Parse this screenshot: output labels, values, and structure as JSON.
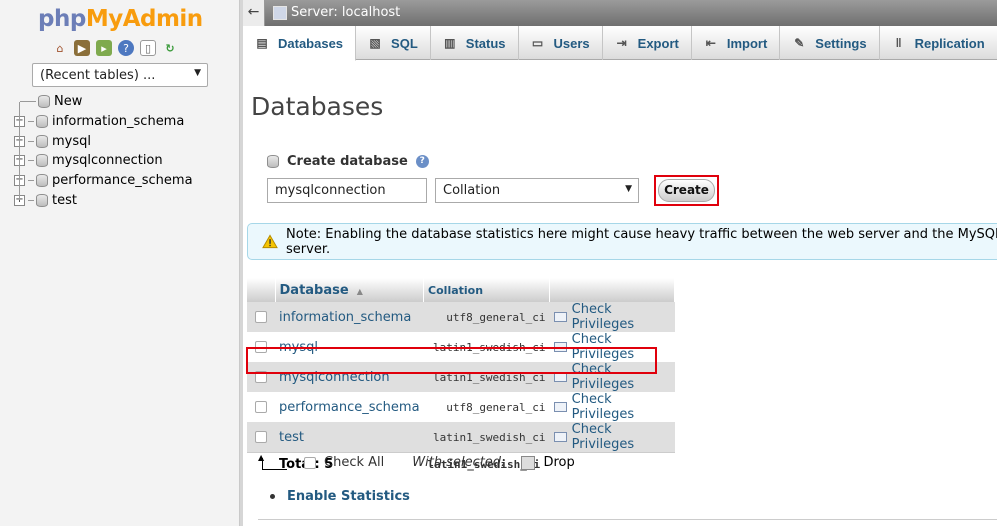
{
  "sidebar": {
    "logo_php": "php",
    "logo_myadmin": "MyAdmin",
    "quick_icons": [
      "home-icon",
      "exit-icon",
      "query-window-icon",
      "documentation-icon",
      "copy-icon",
      "reload-icon"
    ],
    "recent_tables": "(Recent tables) ...",
    "tree": [
      {
        "label": "New",
        "expandable": false
      },
      {
        "label": "information_schema",
        "expandable": true
      },
      {
        "label": "mysql",
        "expandable": true
      },
      {
        "label": "mysqlconnection",
        "expandable": true
      },
      {
        "label": "performance_schema",
        "expandable": true
      },
      {
        "label": "test",
        "expandable": true
      }
    ]
  },
  "topbar": {
    "back": "←",
    "server": "Server: localhost"
  },
  "tabs": [
    {
      "label": "Databases",
      "icon": "database-icon",
      "active": true
    },
    {
      "label": "SQL",
      "icon": "sql-icon",
      "active": false
    },
    {
      "label": "Status",
      "icon": "status-icon",
      "active": false
    },
    {
      "label": "Users",
      "icon": "users-icon",
      "active": false
    },
    {
      "label": "Export",
      "icon": "export-icon",
      "active": false
    },
    {
      "label": "Import",
      "icon": "import-icon",
      "active": false
    },
    {
      "label": "Settings",
      "icon": "settings-icon",
      "active": false
    },
    {
      "label": "Replication",
      "icon": "replication-icon",
      "active": false
    }
  ],
  "main": {
    "title": "Databases",
    "create_label": "Create database",
    "db_name_value": "mysqlconnection",
    "collation_value": "Collation",
    "create_button": "Create",
    "notice": "Note: Enabling the database statistics here might cause heavy traffic between the web server and the MySQL server."
  },
  "table": {
    "headers": {
      "database": "Database",
      "collation": "Collation"
    },
    "rows": [
      {
        "name": "information_schema",
        "collation": "utf8_general_ci",
        "action": "Check Privileges"
      },
      {
        "name": "mysql",
        "collation": "latin1_swedish_ci",
        "action": "Check Privileges"
      },
      {
        "name": "mysqlconnection",
        "collation": "latin1_swedish_ci",
        "action": "Check Privileges"
      },
      {
        "name": "performance_schema",
        "collation": "utf8_general_ci",
        "action": "Check Privileges"
      },
      {
        "name": "test",
        "collation": "latin1_swedish_ci",
        "action": "Check Privileges"
      }
    ],
    "total_label": "Total: 5",
    "total_collation": "latin1_swedish_ci"
  },
  "footer": {
    "check_all": "Check All",
    "with_selected": "With selected:",
    "drop": "Drop",
    "enable_stats": "Enable Statistics"
  },
  "colors": {
    "link": "#235a81",
    "logo_php": "#6c7eb7",
    "logo_myadmin": "#f89c0e",
    "highlight": "#e0000c",
    "notice_bg": "#ebf8fd"
  }
}
